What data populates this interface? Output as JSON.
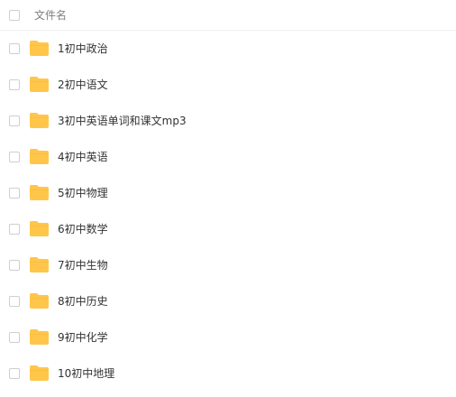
{
  "header": {
    "name_column_label": "文件名"
  },
  "files": [
    {
      "name": "1初中政治",
      "icon": "folder-icon"
    },
    {
      "name": "2初中语文",
      "icon": "folder-icon"
    },
    {
      "name": "3初中英语单词和课文mp3",
      "icon": "folder-icon"
    },
    {
      "name": "4初中英语",
      "icon": "folder-icon"
    },
    {
      "name": "5初中物理",
      "icon": "folder-icon"
    },
    {
      "name": "6初中数学",
      "icon": "folder-icon"
    },
    {
      "name": "7初中生物",
      "icon": "folder-icon"
    },
    {
      "name": "8初中历史",
      "icon": "folder-icon"
    },
    {
      "name": "9初中化学",
      "icon": "folder-icon"
    },
    {
      "name": "10初中地理",
      "icon": "folder-icon"
    }
  ],
  "colors": {
    "folder": "#ffc64a",
    "folder_tab": "#f4b73a",
    "text": "#333333",
    "header_text": "#7f7f7f"
  }
}
